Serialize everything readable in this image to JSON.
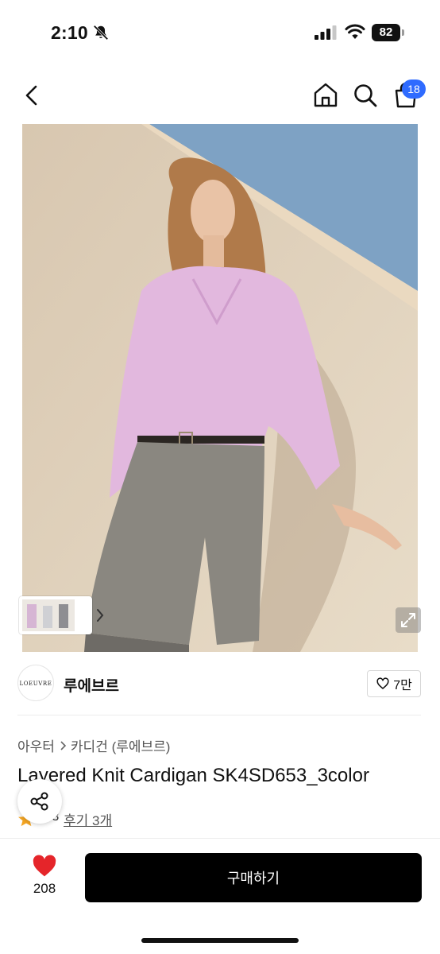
{
  "status_bar": {
    "time": "2:10",
    "battery": "82",
    "icons": [
      "bell-slash-icon",
      "signal-icon",
      "wifi-icon",
      "battery-icon"
    ]
  },
  "header": {
    "icons": [
      "back-icon",
      "home-icon",
      "search-icon",
      "cart-icon"
    ],
    "cart_badge": "18"
  },
  "gallery": {
    "icons": [
      "chevron-right-icon",
      "expand-icon"
    ]
  },
  "brand": {
    "logo_text": "LOEUVRE",
    "name": "루에브르",
    "likes": "7만"
  },
  "breadcrumb": {
    "category": "아우터",
    "subcategory": "카디건 (루에브르)"
  },
  "product": {
    "title": "Layered Knit Cardigan SK4SD653_3color",
    "rating": "4.3",
    "reviews": "후기 3개"
  },
  "bottom_bar": {
    "wish_count": "208",
    "buy_label": "구매하기"
  },
  "colors": {
    "accent_blue": "#2f6bff",
    "heart_red": "#e5252a",
    "star_orange": "#f5a623",
    "buy_button_bg": "#000000"
  }
}
